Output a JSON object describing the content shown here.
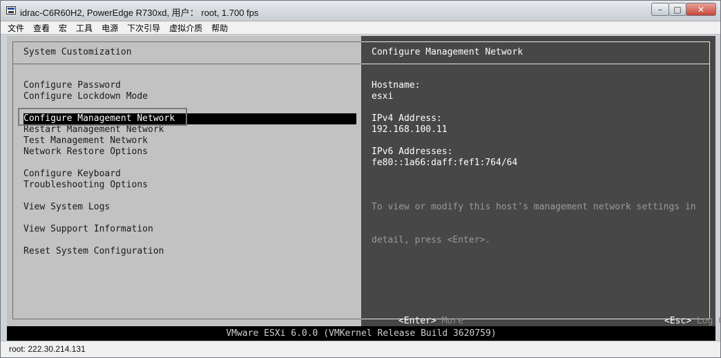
{
  "window": {
    "title": "idrac-C6R60H2, PowerEdge R730xd, 用户： root, 1.700 fps",
    "buttons": {
      "minimize": "–",
      "maximize": "□",
      "close": "✕"
    }
  },
  "menubar": {
    "items": [
      "文件",
      "查看",
      "宏",
      "工具",
      "电源",
      "下次引导",
      "虚拟介质",
      "帮助"
    ]
  },
  "left_panel": {
    "header": "System Customization",
    "options": [
      {
        "label": "Configure Password",
        "selected": false
      },
      {
        "label": "Configure Lockdown Mode",
        "selected": false
      },
      {
        "label": "Configure Management Network",
        "selected": true
      },
      {
        "label": "Restart Management Network",
        "selected": false
      },
      {
        "label": "Test Management Network",
        "selected": false
      },
      {
        "label": "Network Restore Options",
        "selected": false
      },
      {
        "label": "Configure Keyboard",
        "selected": false
      },
      {
        "label": "Troubleshooting Options",
        "selected": false
      },
      {
        "label": "View System Logs",
        "selected": false
      },
      {
        "label": "View Support Information",
        "selected": false
      },
      {
        "label": "Reset System Configuration",
        "selected": false
      }
    ]
  },
  "right_panel": {
    "header": "Configure Management Network",
    "hostname_label": "Hostname:",
    "hostname_value": "esxi",
    "ipv4_label": "IPv4 Address:",
    "ipv4_value": "192.168.100.11",
    "ipv6_label": "IPv6 Addresses:",
    "ipv6_value": "fe80::1a66:daff:fef1:764/64",
    "help_line1": "To view or modify this host's management network settings in",
    "help_line2": "detail, press <Enter>.",
    "footer_left_key": "<Enter>",
    "footer_left_desc": "More",
    "footer_right_key": "<Esc>",
    "footer_right_desc": "Log Out"
  },
  "console_status": "VMware ESXi 6.0.0 (VMKernel Release Build 3620759)",
  "bottom_status": "root: 222.30.214.131",
  "colors": {
    "left_bg": "#c2c2c2",
    "right_bg": "#474747",
    "selected_bg": "#000000",
    "console_bg": "#000000"
  }
}
